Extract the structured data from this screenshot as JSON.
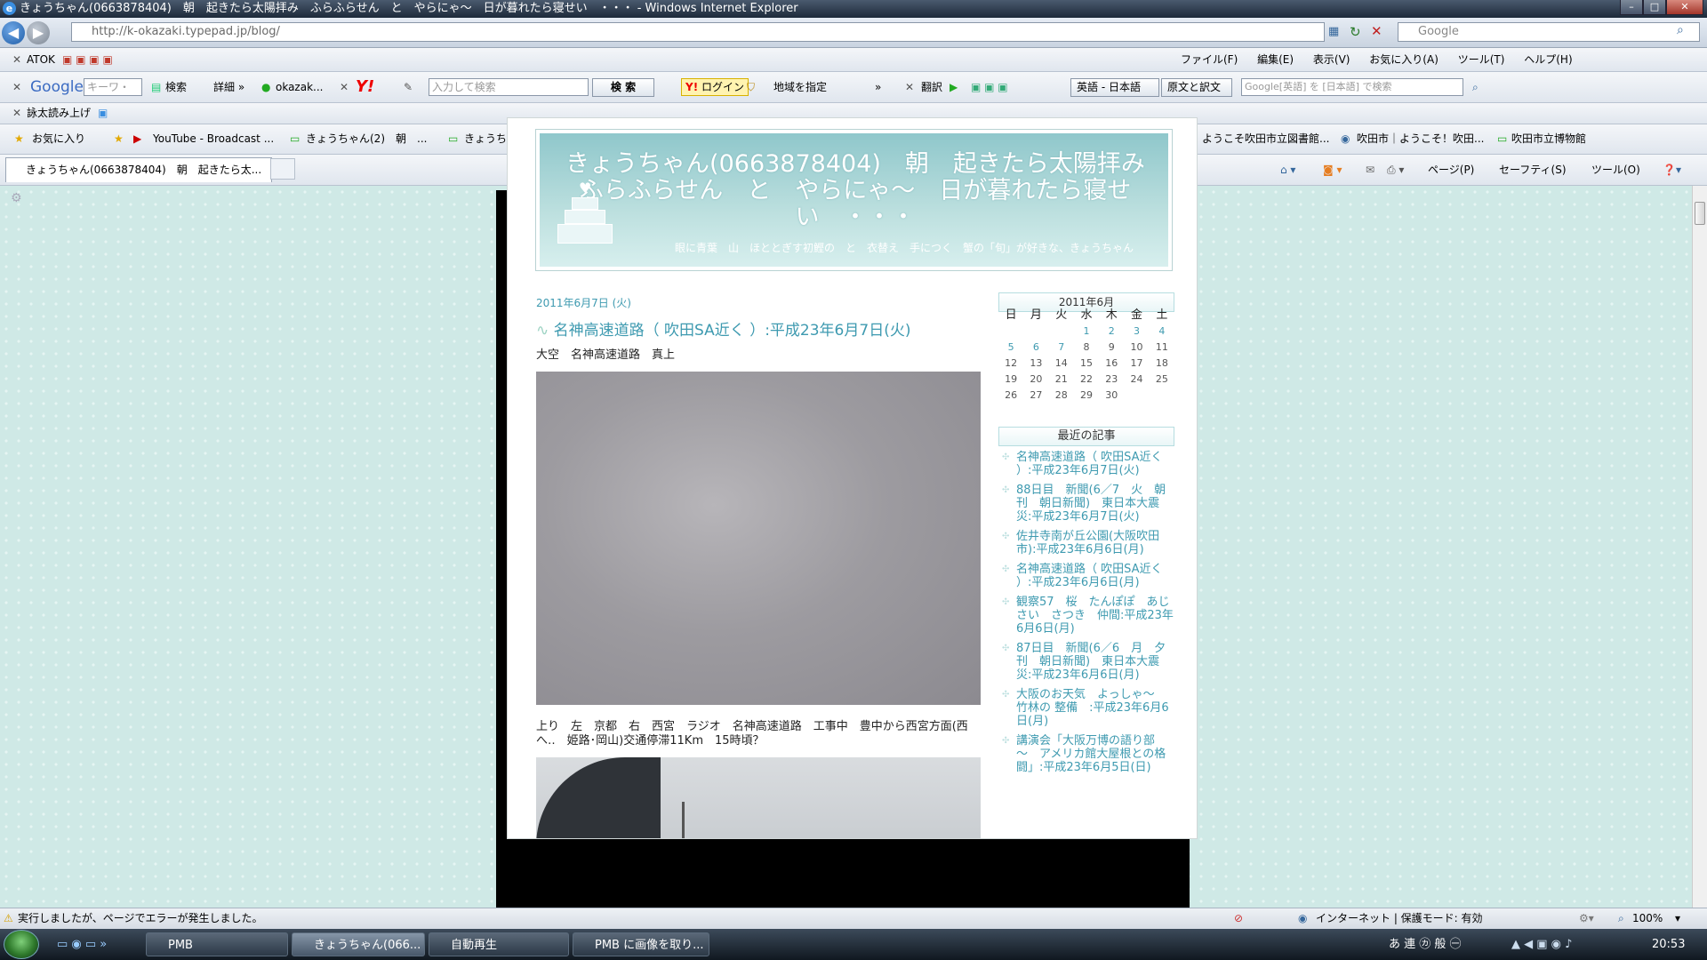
{
  "window": {
    "title": "きょうちゃん(0663878404)　朝　起きたら太陽拝み　ふらふらせん　と　やらにゃ～　日が暮れたら寝せい　・・・ - Windows Internet Explorer",
    "min": "–",
    "max": "□",
    "close": "✕"
  },
  "address": {
    "url": "http://k-okazaki.typepad.jp/blog/",
    "search_placeholder": "Google"
  },
  "toolbar_atok": {
    "label": "ATOK"
  },
  "menu": {
    "items": [
      "ファイル(F)",
      "編集(E)",
      "表示(V)",
      "お気に入り(A)",
      "ツール(T)",
      "ヘルプ(H)"
    ]
  },
  "toolbar_google": {
    "logo": "Google",
    "keyword_placeholder": "キーワ・",
    "search_btn": "検索",
    "detail": "詳細 »",
    "user": "okazak..."
  },
  "toolbar_yahoo": {
    "logo": "Y!",
    "input_placeholder": "入力して検索",
    "search_btn": "検 索",
    "login": "ログイン",
    "region": "地域を指定",
    "more": "»"
  },
  "toolbar_translate": {
    "translate": "翻訳",
    "lang_pair": "英語 - 日本語",
    "mode": "原文と訳文",
    "search_placeholder": "Google[英語] を [日本語] で検索"
  },
  "toolbar_yomiage": {
    "label": "詠太読み上げ"
  },
  "favorites": {
    "label": "お気に入り",
    "items": [
      "YouTube - Broadcast ...",
      "きょうちゃん(2)　朝　...",
      "きょうち",
      "ようこそ吹田市立図書館...",
      "吹田市｜ようこそ！吹田...",
      "吹田市立博物館"
    ]
  },
  "tab": {
    "label": "きょうちゃん(0663878404)　朝　起きたら太..."
  },
  "command_bar": {
    "items": [
      "ページ(P)",
      "セーフティ(S)",
      "ツール(O)"
    ]
  },
  "blog": {
    "title": "きょうちゃん(0663878404)　朝　起きたら太陽拝み　ふらふらせん　と　やらにゃ～　日が暮れたら寝せい　・・・",
    "subtitle": "眼に青葉　山　ほととぎす初鰹の　と　衣替え　手につく　蟹の「旬」が好きな、きょうちゃん",
    "post_date": "2011年6月7日 (火)",
    "post_title": "名神高速道路（ 吹田SA近く ）:平成23年6月7日(火)",
    "text1": "大空　名神高速道路　真上",
    "text2": "上り　左　京都　右　西宮　ラジオ　名神高速道路　工事中　豊中から西宮方面(西へ‥　姫路･岡山)交通停滞11Km　15時頃？",
    "calendar_title": "2011年6月",
    "weekdays": [
      "日",
      "月",
      "火",
      "水",
      "木",
      "金",
      "土"
    ],
    "calendar_rows": [
      [
        "",
        "",
        "",
        "1",
        "2",
        "3",
        "4"
      ],
      [
        "5",
        "6",
        "7",
        "8",
        "9",
        "10",
        "11"
      ],
      [
        "12",
        "13",
        "14",
        "15",
        "16",
        "17",
        "18"
      ],
      [
        "19",
        "20",
        "21",
        "22",
        "23",
        "24",
        "25"
      ],
      [
        "26",
        "27",
        "28",
        "29",
        "30",
        "",
        ""
      ]
    ],
    "recent_title": "最近の記事",
    "recent": [
      "名神高速道路（ 吹田SA近く ）:平成23年6月7日(火)",
      "88日目　新聞(6／7　火　朝刊　朝日新聞)　東日本大震災:平成23年6月7日(火)",
      "佐井寺南が丘公園(大阪吹田市):平成23年6月6日(月)",
      "名神高速道路（ 吹田SA近く ）:平成23年6月6日(月)",
      "観察57　桜　たんぽぽ　あじさい　さつき　仲間:平成23年6月6日(月)",
      "87日目　新聞(6／6　月　夕刊　朝日新聞)　東日本大震災:平成23年6月6日(月)",
      "大阪のお天気　よっしゃ～　竹林の 整備　:平成23年6月6日(月)",
      "講演会「大阪万博の語り部　～　アメリカ館大屋根との格闘」:平成23年6月5日(日)"
    ]
  },
  "status": {
    "error": "実行しましたが、ページでエラーが発生しました。",
    "zone": "インターネット | 保護モード: 有効",
    "zoom": "100%"
  },
  "taskbar": {
    "buttons": [
      "PMB",
      "きょうちゃん(066...",
      "自動再生",
      "PMB に画像を取り..."
    ],
    "ime": "あ 連 ㋕ 般 ㊀",
    "clock": "20:53"
  }
}
